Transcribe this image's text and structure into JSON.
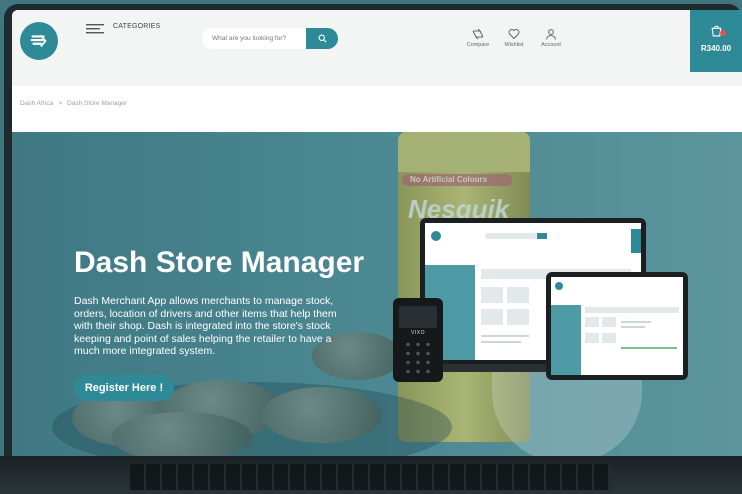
{
  "header": {
    "categories_label": "CATEGORIES",
    "search_placeholder": "What are you looking for?",
    "compare_label": "Compare",
    "wishlist_label": "Wishlist",
    "account_label": "Account",
    "cart_amount": "R340.00"
  },
  "breadcrumb": {
    "items": [
      "Dash Africa",
      "Dash Store Manager"
    ],
    "separator": ">"
  },
  "hero": {
    "title": "Dash Store Manager",
    "description": "Dash Merchant App allows merchants to manage stock, orders, location of drivers and other items that help them with their shop. Dash is integrated into the store's stock keeping and point of sales helping the retailer to have a much more integrated system.",
    "cta_label": "Register Here !",
    "jar_label": "No Artificial Colours",
    "jar_brand": "Nesquik",
    "pos_brand": "VIXO"
  },
  "colors": {
    "brand": "#2f8a97",
    "hero_bg": "#4a8791",
    "header_bg": "#f3f4f4"
  },
  "icons": [
    "logo-icon",
    "menu-icon",
    "search-icon",
    "compare-icon",
    "heart-icon",
    "user-icon",
    "cart-icon"
  ]
}
